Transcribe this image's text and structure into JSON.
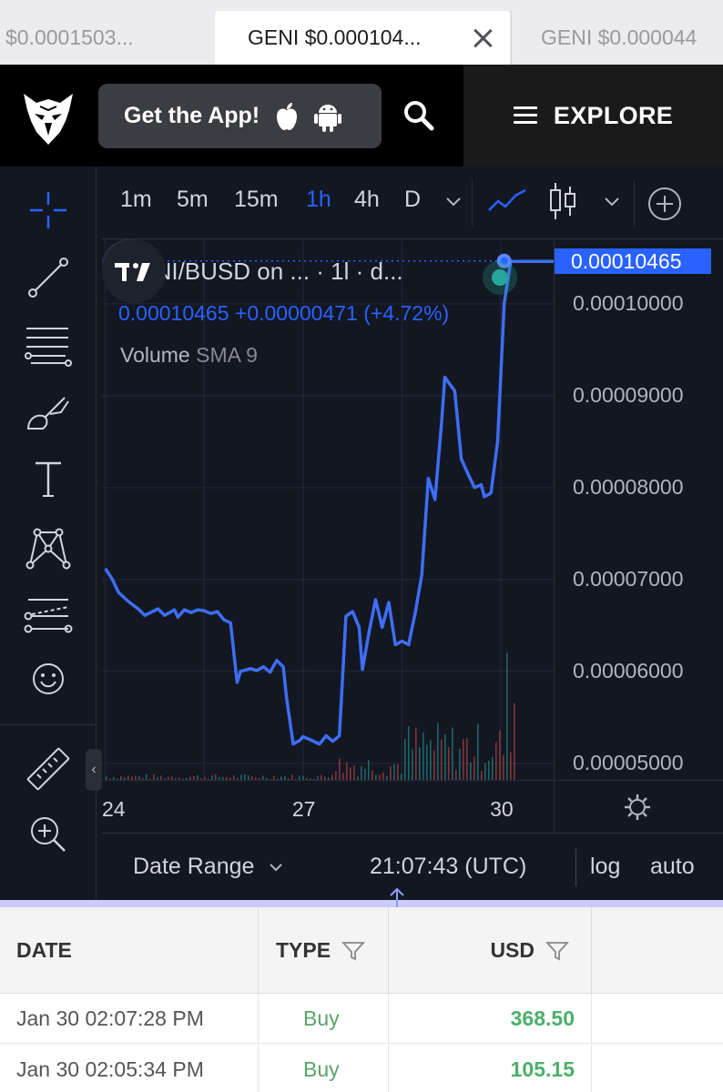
{
  "browser": {
    "tabs": [
      {
        "label": "$0.0001503...",
        "active": false
      },
      {
        "label": "GENI $0.000104...",
        "active": true
      },
      {
        "label": "GENI $0.000044",
        "active": false
      }
    ]
  },
  "header": {
    "get_app_label": "Get the App!",
    "explore_label": "EXPLORE"
  },
  "chart_toolbar": {
    "timeframes": [
      "1m",
      "5m",
      "15m",
      "1h",
      "4h",
      "D"
    ],
    "active_timeframe": "1h"
  },
  "legend": {
    "title": "GENI/BUSD on ... · 1l · d...",
    "price_line": "0.00010465  +0.00000471  (+4.72%)",
    "volume_label": "Volume",
    "volume_sma": "SMA 9"
  },
  "bottom_bar": {
    "date_range_label": "Date Range",
    "clock": "21:07:43 (UTC)",
    "log_label": "log",
    "auto_label": "auto"
  },
  "colors": {
    "line": "#3d6ef5",
    "accent": "#2962ff",
    "buy": "#4caf6a",
    "chart_bg": "#131722"
  },
  "chart_data": {
    "type": "line",
    "symbol": "GENI/BUSD",
    "last_price": "0.00010465",
    "price_axis_labels": [
      "0.00010000",
      "0.00009000",
      "0.00008000",
      "0.00007000",
      "0.00006000",
      "0.00005000"
    ],
    "time_axis_labels": [
      "24",
      "27",
      "30"
    ],
    "ylim": [
      4.82e-05,
      0.000107
    ],
    "series": [
      {
        "x": [
          24.0,
          24.1,
          24.2,
          24.35,
          24.5,
          24.6,
          24.8,
          24.9,
          25.05,
          25.1,
          25.2,
          25.3,
          25.4,
          25.5,
          25.6,
          25.7,
          25.8,
          25.9,
          26.0,
          26.05,
          26.2,
          26.3,
          26.4,
          26.5,
          26.6,
          26.7,
          26.75,
          26.85,
          26.95,
          27.0,
          27.1,
          27.25,
          27.35,
          27.45,
          27.55,
          27.65,
          27.75,
          27.85,
          27.9,
          28.0,
          28.1,
          28.2,
          28.3,
          28.4,
          28.5,
          28.6,
          28.7,
          28.8,
          28.9,
          29.0,
          29.1,
          29.15,
          29.3,
          29.4,
          29.5,
          29.6,
          29.7,
          29.75,
          29.85,
          29.95,
          30.05,
          30.15,
          30.25,
          30.35,
          30.45,
          30.55,
          30.65,
          30.7,
          30.75,
          30.8
        ],
        "values": [
          7.12e-05,
          7.01e-05,
          6.86e-05,
          6.76e-05,
          6.68e-05,
          6.61e-05,
          6.68e-05,
          6.61e-05,
          6.67e-05,
          6.59e-05,
          6.67e-05,
          6.64e-05,
          6.67e-05,
          6.66e-05,
          6.63e-05,
          6.65e-05,
          6.56e-05,
          6.53e-05,
          5.88e-05,
          6e-05,
          6.03e-05,
          6.01e-05,
          6.05e-05,
          5.99e-05,
          6.12e-05,
          6.05e-05,
          5.71e-05,
          5.21e-05,
          5.25e-05,
          5.29e-05,
          5.26e-05,
          5.21e-05,
          5.3e-05,
          5.24e-05,
          5.3e-05,
          6.6e-05,
          6.65e-05,
          6.48e-05,
          6.02e-05,
          6.43e-05,
          6.78e-05,
          6.48e-05,
          6.75e-05,
          6.29e-05,
          6.33e-05,
          6.29e-05,
          6.63e-05,
          7.05e-05,
          8.1e-05,
          7.87e-05,
          8.7e-05,
          9.2e-05,
          9.05e-05,
          8.31e-05,
          8.15e-05,
          8e-05,
          8.03e-05,
          7.9e-05,
          7.94e-05,
          8.5e-05,
          0.0001,
          0.0001046,
          0.0001046,
          0.0001046,
          0.0001046,
          0.0001046,
          0.0001046,
          0.0001046,
          0.0001046,
          0.0001046
        ]
      }
    ],
    "xlim": [
      23.95,
      30.8
    ],
    "volume_visible": true,
    "grid": true
  },
  "trades_table": {
    "columns": [
      "DATE",
      "TYPE",
      "USD"
    ],
    "rows": [
      {
        "date": "Jan 30 02:07:28 PM",
        "type": "Buy",
        "usd": "368.50"
      },
      {
        "date": "Jan 30 02:05:34 PM",
        "type": "Buy",
        "usd": "105.15"
      }
    ]
  }
}
